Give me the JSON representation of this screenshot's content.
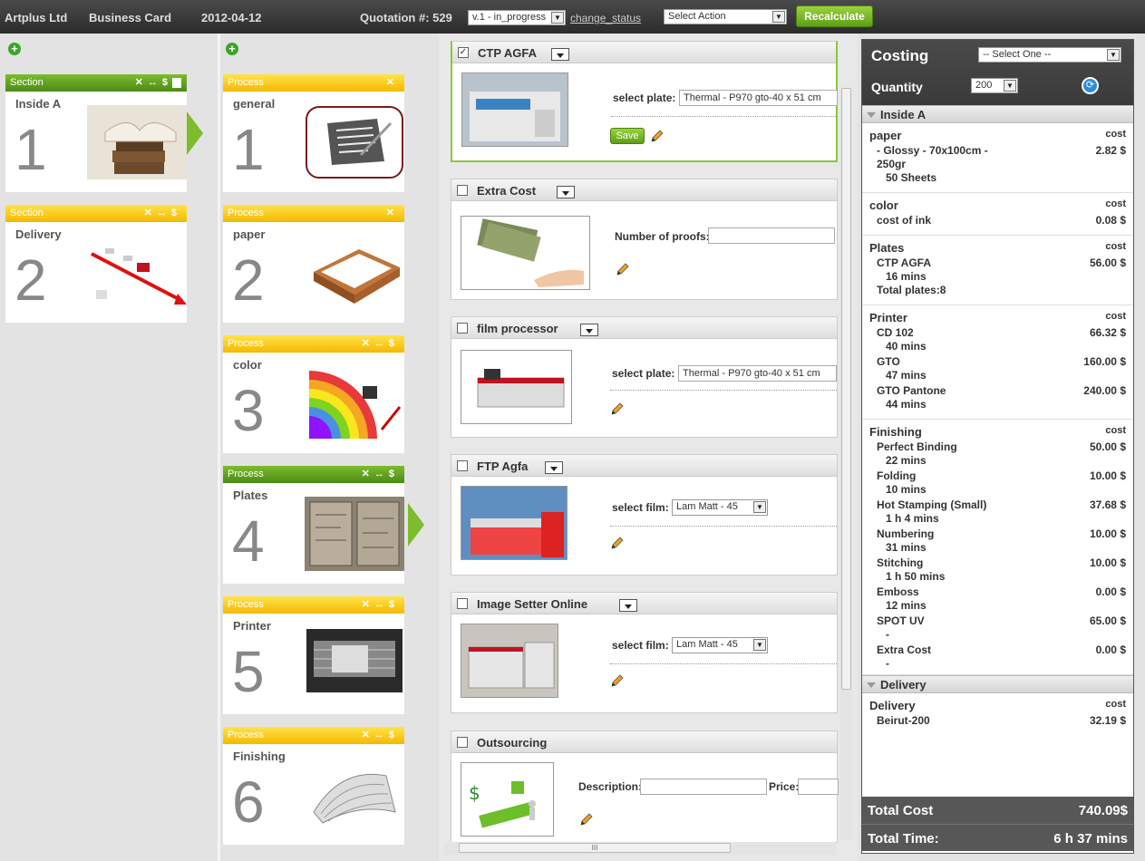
{
  "topbar": {
    "company": "Artplus Ltd",
    "product": "Business Card",
    "date": "2012-04-12",
    "quotation_label": "Quotation #: 529",
    "version_select": "v.1 - in_progress",
    "change_status": "change_status",
    "action_select": "Select Action",
    "recalculate": "Recalculate"
  },
  "sections": [
    {
      "header": "Section",
      "name": "Inside A",
      "number": "1",
      "color": "green"
    },
    {
      "header": "Section",
      "name": "Delivery",
      "number": "2",
      "color": "yellow"
    }
  ],
  "processes": [
    {
      "header": "Process",
      "name": "general",
      "number": "1"
    },
    {
      "header": "Process",
      "name": "paper",
      "number": "2"
    },
    {
      "header": "Process",
      "name": "color",
      "number": "3"
    },
    {
      "header": "Process",
      "name": "Plates",
      "number": "4"
    },
    {
      "header": "Process",
      "name": "Printer",
      "number": "5"
    },
    {
      "header": "Process",
      "name": "Finishing",
      "number": "6"
    }
  ],
  "panels": {
    "ctp": {
      "title": "CTP AGFA",
      "checked": "✓",
      "label": "select plate:",
      "value": "Thermal - P970 gto-40 x 51 cm",
      "save": "Save"
    },
    "extra": {
      "title": "Extra Cost",
      "label": "Number of proofs:"
    },
    "film": {
      "title": "film processor",
      "label": "select plate:",
      "value": "Thermal - P970 gto-40 x 51 cm"
    },
    "ftp": {
      "title": "FTP Agfa",
      "label": "select film:",
      "value": "Lam Matt - 45"
    },
    "imagesetter": {
      "title": "Image Setter Online",
      "label": "select film:",
      "value": "Lam Matt - 45"
    },
    "outsourcing": {
      "title": "Outsourcing",
      "desc_label": "Description:",
      "price_label": "Price:"
    }
  },
  "costing": {
    "title": "Costing",
    "select": "-- Select One --",
    "quantity_label": "Quantity",
    "quantity": "200",
    "cost_col": "cost",
    "section1": "Inside A",
    "paper": {
      "title": "paper",
      "line1": "- Glossy - 70x100cm -",
      "line2": "250gr",
      "line3": "50 Sheets",
      "value": "2.82 $"
    },
    "color": {
      "title": "color",
      "line1": "cost of ink",
      "value": "0.08 $"
    },
    "plates": {
      "title": "Plates",
      "line1": "CTP AGFA",
      "line2": "16 mins",
      "line3": "Total plates:8",
      "value": "56.00 $"
    },
    "printer": {
      "title": "Printer",
      "items": [
        {
          "name": "CD 102",
          "time": "40 mins",
          "value": "66.32 $"
        },
        {
          "name": "GTO",
          "time": "47 mins",
          "value": "160.00 $"
        },
        {
          "name": "GTO Pantone",
          "time": "44 mins",
          "value": "240.00 $"
        }
      ]
    },
    "finishing": {
      "title": "Finishing",
      "items": [
        {
          "name": "Perfect Binding",
          "time": "22 mins",
          "value": "50.00 $"
        },
        {
          "name": "Folding",
          "time": "10 mins",
          "value": "10.00 $"
        },
        {
          "name": "Hot Stamping (Small)",
          "time": "1 h 4 mins",
          "value": "37.68 $"
        },
        {
          "name": "Numbering",
          "time": "31 mins",
          "value": "10.00 $"
        },
        {
          "name": "Stitching",
          "time": "1 h 50 mins",
          "value": "10.00 $"
        },
        {
          "name": "Emboss",
          "time": "12 mins",
          "value": "0.00 $"
        },
        {
          "name": "SPOT UV",
          "time": "-",
          "value": "65.00 $"
        },
        {
          "name": "Extra Cost",
          "time": "-",
          "value": "0.00 $"
        }
      ]
    },
    "section2": "Delivery",
    "delivery": {
      "title": "Delivery",
      "line1": "Beirut-200",
      "value": "32.19 $"
    },
    "total_cost_label": "Total Cost",
    "total_cost": "740.09$",
    "total_time_label": "Total Time:",
    "total_time": "6 h 37 mins"
  }
}
